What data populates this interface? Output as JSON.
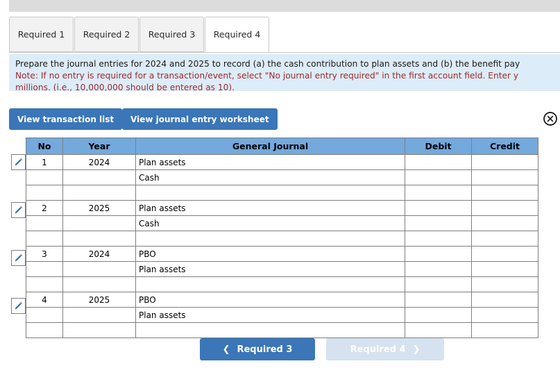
{
  "theme": {
    "accent_blue": "#3a76b8",
    "header_blue": "#74a9dd",
    "info_blue": "#dcecf8",
    "note_red": "#9e2a2b",
    "disabled_blue": "#d6e2ef",
    "top_strip_gray": "#dcdcdc"
  },
  "tabs": [
    {
      "label": "Required 1",
      "active": false
    },
    {
      "label": "Required 2",
      "active": false
    },
    {
      "label": "Required 3",
      "active": false
    },
    {
      "label": "Required 4",
      "active": true
    }
  ],
  "instructions": {
    "line1": "Prepare the journal entries for 2024 and 2025 to record (a) the cash contribution to plan assets and (b) the benefit pay",
    "line2": "Note: If no entry is required for a transaction/event, select \"No journal entry required\" in the first account field. Enter y",
    "line3": "millions. (i.e., 10,000,000 should be entered as 10)."
  },
  "toolbar": {
    "view_transaction_list": "View transaction list",
    "view_journal_entry_worksheet": "View journal entry worksheet",
    "close_icon": "close-circle-icon"
  },
  "table": {
    "columns": [
      "No",
      "Year",
      "General Journal",
      "Debit",
      "Credit"
    ],
    "rows": [
      {
        "edit_icon": "pencil-icon",
        "no": "1",
        "year": "2024",
        "general_journal": "Plan assets",
        "debit": "",
        "credit": ""
      },
      {
        "edit_icon": "",
        "no": "",
        "year": "",
        "general_journal": "Cash",
        "debit": "",
        "credit": ""
      },
      {
        "edit_icon": "",
        "no": "",
        "year": "",
        "general_journal": "",
        "debit": "",
        "credit": ""
      },
      {
        "edit_icon": "pencil-icon",
        "no": "2",
        "year": "2025",
        "general_journal": "Plan assets",
        "debit": "",
        "credit": ""
      },
      {
        "edit_icon": "",
        "no": "",
        "year": "",
        "general_journal": "Cash",
        "debit": "",
        "credit": ""
      },
      {
        "edit_icon": "",
        "no": "",
        "year": "",
        "general_journal": "",
        "debit": "",
        "credit": ""
      },
      {
        "edit_icon": "pencil-icon",
        "no": "3",
        "year": "2024",
        "general_journal": "PBO",
        "debit": "",
        "credit": ""
      },
      {
        "edit_icon": "",
        "no": "",
        "year": "",
        "general_journal": "Plan assets",
        "debit": "",
        "credit": ""
      },
      {
        "edit_icon": "",
        "no": "",
        "year": "",
        "general_journal": "",
        "debit": "",
        "credit": ""
      },
      {
        "edit_icon": "pencil-icon",
        "no": "4",
        "year": "2025",
        "general_journal": "PBO",
        "debit": "",
        "credit": ""
      },
      {
        "edit_icon": "",
        "no": "",
        "year": "",
        "general_journal": "Plan assets",
        "debit": "",
        "credit": ""
      },
      {
        "edit_icon": "",
        "no": "",
        "year": "",
        "general_journal": "",
        "debit": "",
        "credit": ""
      }
    ]
  },
  "navigation": {
    "prev_label": "Required 3",
    "next_label": "Required 4",
    "prev_chevron": "chevron-left-icon",
    "next_chevron": "chevron-right-icon",
    "next_disabled": true
  }
}
